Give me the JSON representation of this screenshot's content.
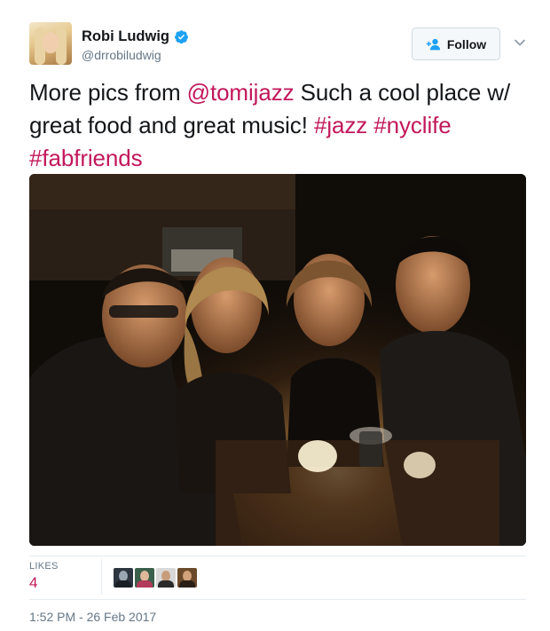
{
  "author": {
    "display_name": "Robi Ludwig",
    "handle": "@drrobiludwig",
    "verified": true
  },
  "follow_button": {
    "label": "Follow"
  },
  "tweet": {
    "segments": [
      {
        "text": "More pics from ",
        "type": "text"
      },
      {
        "text": "@tomijazz",
        "type": "link"
      },
      {
        "text": " Such a cool place w/ great food and great music! ",
        "type": "text"
      },
      {
        "text": "#jazz",
        "type": "link"
      },
      {
        "text": " ",
        "type": "text"
      },
      {
        "text": "#nyclife",
        "type": "link"
      },
      {
        "text": " ",
        "type": "text"
      },
      {
        "text": "#fabfriends",
        "type": "link"
      }
    ]
  },
  "stats": {
    "likes_label": "LIKES",
    "likes_count": "4"
  },
  "timestamp": "1:52 PM - 26 Feb 2017",
  "colors": {
    "link": "#c2185b",
    "verified": "#1da1f2",
    "secondary_text": "#657786"
  }
}
